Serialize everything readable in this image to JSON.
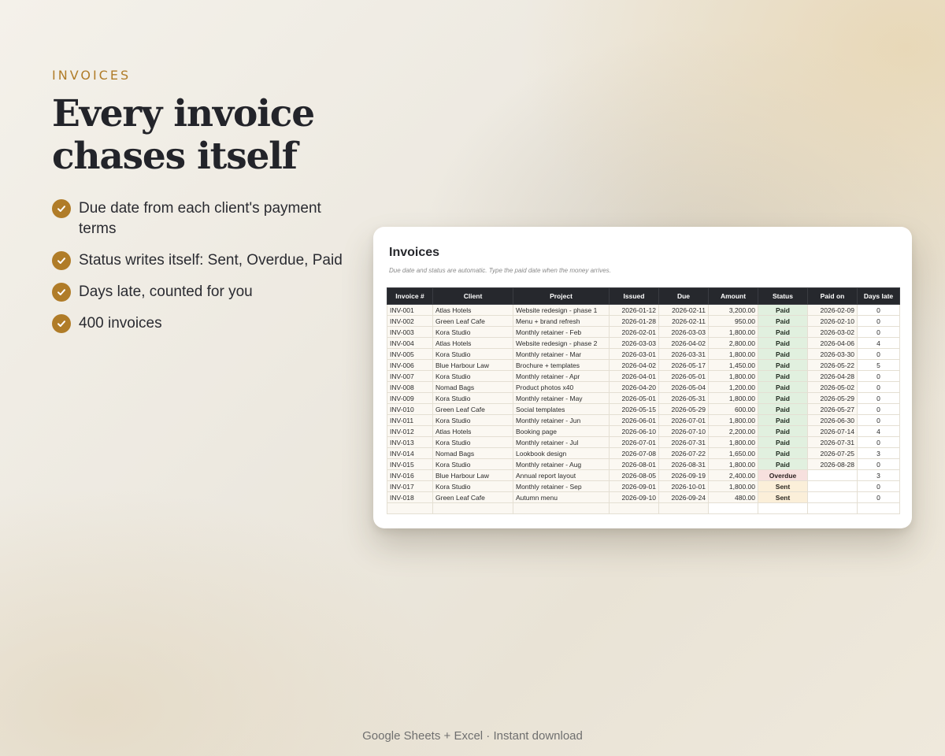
{
  "eyebrow": "INVOICES",
  "headline": "Every invoice chases itself",
  "features": [
    "Due date from each client's payment terms",
    "Status writes itself: Sent, Overdue, Paid",
    "Days late, counted for you",
    "400 invoices"
  ],
  "sheet": {
    "title": "Invoices",
    "subtitle": "Due date and status are automatic. Type the paid date when the money arrives.",
    "columns": [
      "Invoice #",
      "Client",
      "Project",
      "Issued",
      "Due",
      "Amount",
      "Status",
      "Paid on",
      "Days late"
    ],
    "rows": [
      [
        "INV-001",
        "Atlas Hotels",
        "Website redesign - phase 1",
        "2026-01-12",
        "2026-02-11",
        "3,200.00",
        "Paid",
        "2026-02-09",
        "0"
      ],
      [
        "INV-002",
        "Green Leaf Cafe",
        "Menu + brand refresh",
        "2026-01-28",
        "2026-02-11",
        "950.00",
        "Paid",
        "2026-02-10",
        "0"
      ],
      [
        "INV-003",
        "Kora Studio",
        "Monthly retainer - Feb",
        "2026-02-01",
        "2026-03-03",
        "1,800.00",
        "Paid",
        "2026-03-02",
        "0"
      ],
      [
        "INV-004",
        "Atlas Hotels",
        "Website redesign - phase 2",
        "2026-03-03",
        "2026-04-02",
        "2,800.00",
        "Paid",
        "2026-04-06",
        "4"
      ],
      [
        "INV-005",
        "Kora Studio",
        "Monthly retainer - Mar",
        "2026-03-01",
        "2026-03-31",
        "1,800.00",
        "Paid",
        "2026-03-30",
        "0"
      ],
      [
        "INV-006",
        "Blue Harbour Law",
        "Brochure + templates",
        "2026-04-02",
        "2026-05-17",
        "1,450.00",
        "Paid",
        "2026-05-22",
        "5"
      ],
      [
        "INV-007",
        "Kora Studio",
        "Monthly retainer - Apr",
        "2026-04-01",
        "2026-05-01",
        "1,800.00",
        "Paid",
        "2026-04-28",
        "0"
      ],
      [
        "INV-008",
        "Nomad Bags",
        "Product photos x40",
        "2026-04-20",
        "2026-05-04",
        "1,200.00",
        "Paid",
        "2026-05-02",
        "0"
      ],
      [
        "INV-009",
        "Kora Studio",
        "Monthly retainer - May",
        "2026-05-01",
        "2026-05-31",
        "1,800.00",
        "Paid",
        "2026-05-29",
        "0"
      ],
      [
        "INV-010",
        "Green Leaf Cafe",
        "Social templates",
        "2026-05-15",
        "2026-05-29",
        "600.00",
        "Paid",
        "2026-05-27",
        "0"
      ],
      [
        "INV-011",
        "Kora Studio",
        "Monthly retainer - Jun",
        "2026-06-01",
        "2026-07-01",
        "1,800.00",
        "Paid",
        "2026-06-30",
        "0"
      ],
      [
        "INV-012",
        "Atlas Hotels",
        "Booking page",
        "2026-06-10",
        "2026-07-10",
        "2,200.00",
        "Paid",
        "2026-07-14",
        "4"
      ],
      [
        "INV-013",
        "Kora Studio",
        "Monthly retainer - Jul",
        "2026-07-01",
        "2026-07-31",
        "1,800.00",
        "Paid",
        "2026-07-31",
        "0"
      ],
      [
        "INV-014",
        "Nomad Bags",
        "Lookbook design",
        "2026-07-08",
        "2026-07-22",
        "1,650.00",
        "Paid",
        "2026-07-25",
        "3"
      ],
      [
        "INV-015",
        "Kora Studio",
        "Monthly retainer - Aug",
        "2026-08-01",
        "2026-08-31",
        "1,800.00",
        "Paid",
        "2026-08-28",
        "0"
      ],
      [
        "INV-016",
        "Blue Harbour Law",
        "Annual report layout",
        "2026-08-05",
        "2026-09-19",
        "2,400.00",
        "Overdue",
        "",
        "3"
      ],
      [
        "INV-017",
        "Kora Studio",
        "Monthly retainer - Sep",
        "2026-09-01",
        "2026-10-01",
        "1,800.00",
        "Sent",
        "",
        "0"
      ],
      [
        "INV-018",
        "Green Leaf Cafe",
        "Autumn menu",
        "2026-09-10",
        "2026-09-24",
        "480.00",
        "Sent",
        "",
        "0"
      ]
    ]
  },
  "footer": "Google Sheets + Excel  ·  Instant download",
  "colors": {
    "accent": "#b07c28",
    "header_dark": "#26282d",
    "status_paid": "#e1f0df",
    "status_overdue": "#f7e0de",
    "status_sent": "#fbefd9"
  },
  "icons": {
    "feature_bullet": "check-circle-icon"
  }
}
